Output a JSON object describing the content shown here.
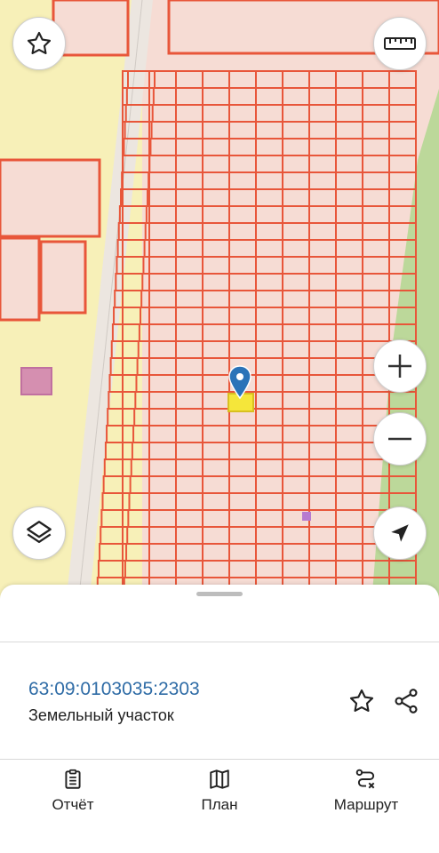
{
  "map": {
    "colors": {
      "parcel_fill": "#f6dcd4",
      "parcel_line": "#e8563a",
      "zone_yellow": "#f7f0b8",
      "road": "#ece6e0",
      "green": "#bcd89a",
      "marker": "#2a73b8",
      "highlight": "#f5e63a"
    },
    "controls": {
      "favorite": "star-icon",
      "ruler": "ruler-icon",
      "zoom_in": "plus-icon",
      "zoom_out": "minus-icon",
      "layers": "layers-icon",
      "locate": "navigation-arrow-icon"
    }
  },
  "sheet": {
    "parcel_number": "63:09:0103035:2303",
    "parcel_type": "Земельный участок"
  },
  "tabs": [
    {
      "label": "Отчёт",
      "icon": "clipboard-icon"
    },
    {
      "label": "План",
      "icon": "map-icon"
    },
    {
      "label": "Маршрут",
      "icon": "route-icon"
    }
  ]
}
